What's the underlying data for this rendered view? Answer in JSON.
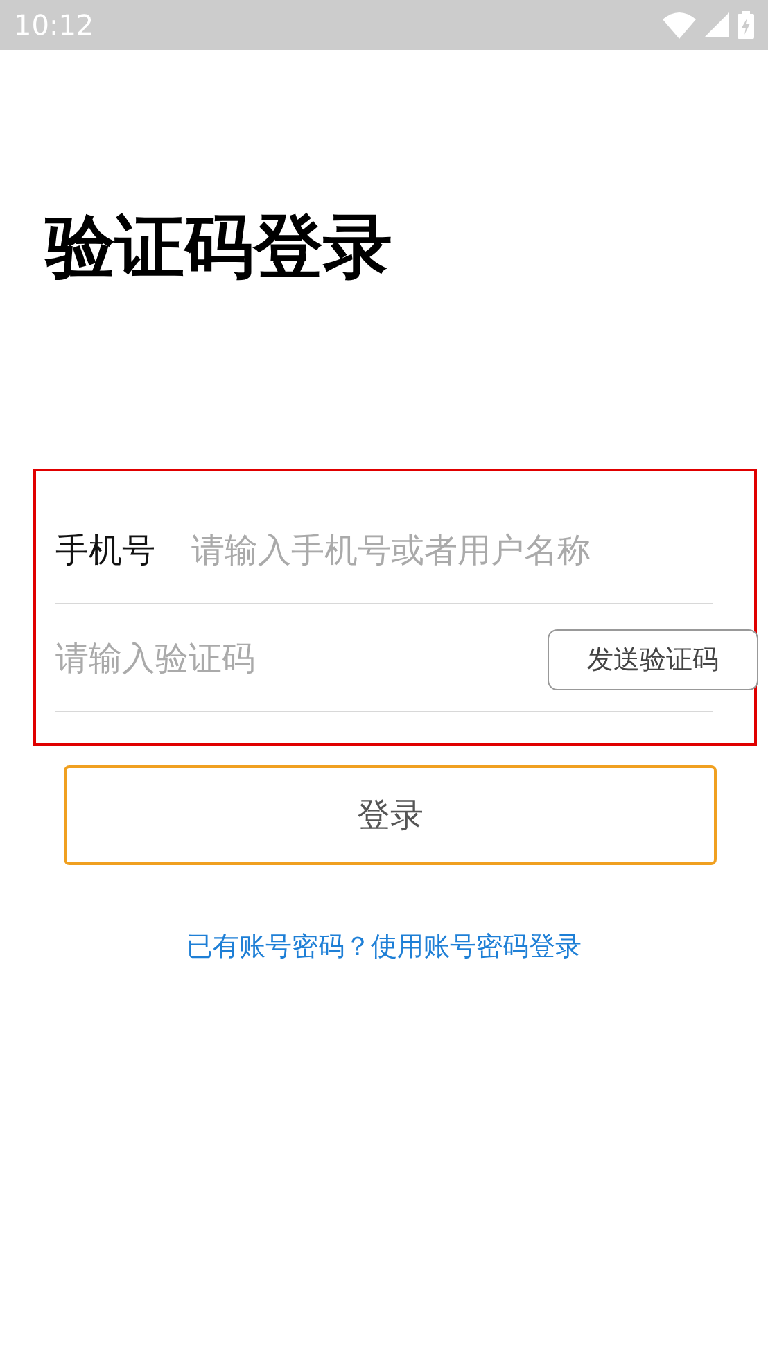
{
  "status_bar": {
    "time": "10:12"
  },
  "title": "验证码登录",
  "form": {
    "highlighted": true,
    "phone": {
      "label": "手机号",
      "placeholder": "请输入手机号或者用户名称"
    },
    "code": {
      "placeholder": "请输入验证码"
    },
    "send_button": "发送验证码"
  },
  "login_button": "登录",
  "link": "已有账号密码？使用账号密码登录"
}
